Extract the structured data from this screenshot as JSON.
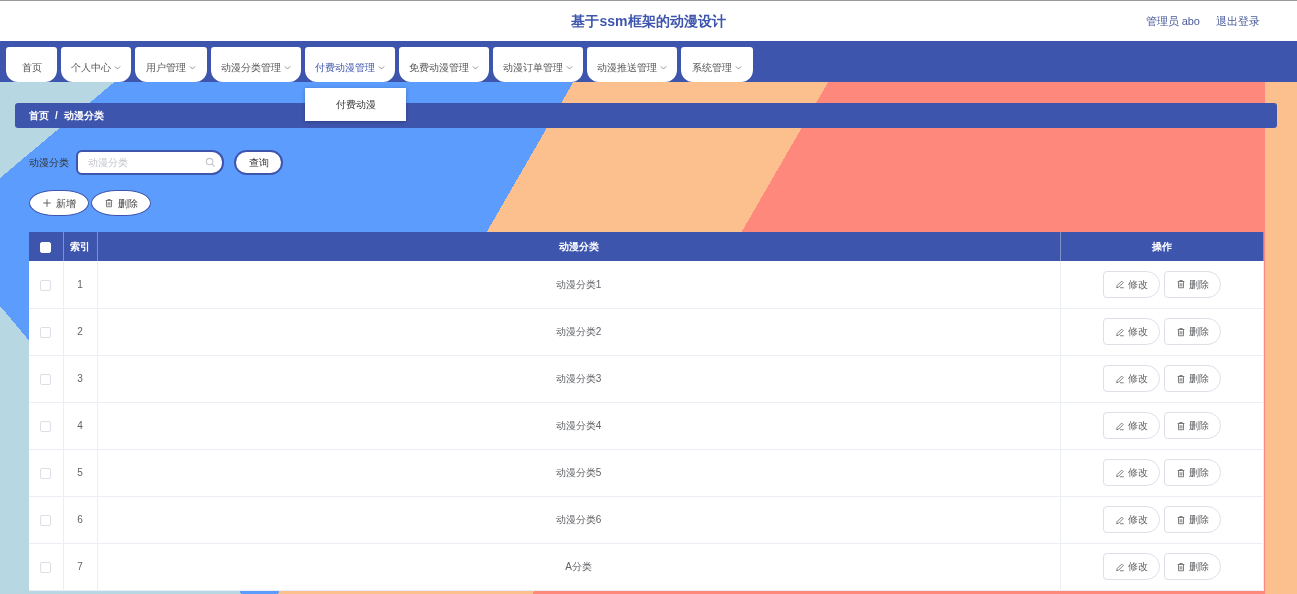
{
  "header": {
    "title": "基于ssm框架的动漫设计",
    "user": "管理员 abo",
    "logout": "退出登录"
  },
  "nav": [
    {
      "label": "首页",
      "has_menu": false,
      "expanded": false
    },
    {
      "label": "个人中心",
      "has_menu": true,
      "expanded": false
    },
    {
      "label": "用户管理",
      "has_menu": true,
      "expanded": false
    },
    {
      "label": "动漫分类管理",
      "has_menu": true,
      "expanded": false
    },
    {
      "label": "付费动漫管理",
      "has_menu": true,
      "expanded": true,
      "menu": [
        "付费动漫"
      ]
    },
    {
      "label": "免费动漫管理",
      "has_menu": true,
      "expanded": false
    },
    {
      "label": "动漫订单管理",
      "has_menu": true,
      "expanded": false
    },
    {
      "label": "动漫推送管理",
      "has_menu": true,
      "expanded": false
    },
    {
      "label": "系统管理",
      "has_menu": true,
      "expanded": false
    }
  ],
  "breadcrumb": {
    "items": [
      "首页",
      "动漫分类"
    ],
    "separator": "/"
  },
  "search": {
    "label": "动漫分类",
    "placeholder": "动漫分类",
    "button": "查询"
  },
  "actions": [
    {
      "kind": "add",
      "label": "新增"
    },
    {
      "kind": "delete",
      "label": "删除"
    }
  ],
  "table": {
    "select_all_checked": false,
    "columns": [
      "索引",
      "动漫分类",
      "操作"
    ],
    "rows": [
      {
        "checked": false,
        "index": "1",
        "category": "动漫分类1",
        "actions": [
          {
            "kind": "edit",
            "label": "修改"
          },
          {
            "kind": "delete",
            "label": "删除"
          }
        ]
      },
      {
        "checked": false,
        "index": "2",
        "category": "动漫分类2",
        "actions": [
          {
            "kind": "edit",
            "label": "修改"
          },
          {
            "kind": "delete",
            "label": "删除"
          }
        ]
      },
      {
        "checked": false,
        "index": "3",
        "category": "动漫分类3",
        "actions": [
          {
            "kind": "edit",
            "label": "修改"
          },
          {
            "kind": "delete",
            "label": "删除"
          }
        ]
      },
      {
        "checked": false,
        "index": "4",
        "category": "动漫分类4",
        "actions": [
          {
            "kind": "edit",
            "label": "修改"
          },
          {
            "kind": "delete",
            "label": "删除"
          }
        ]
      },
      {
        "checked": false,
        "index": "5",
        "category": "动漫分类5",
        "actions": [
          {
            "kind": "edit",
            "label": "修改"
          },
          {
            "kind": "delete",
            "label": "删除"
          }
        ]
      },
      {
        "checked": false,
        "index": "6",
        "category": "动漫分类6",
        "actions": [
          {
            "kind": "edit",
            "label": "修改"
          },
          {
            "kind": "delete",
            "label": "删除"
          }
        ]
      },
      {
        "checked": false,
        "index": "7",
        "category": "A分类",
        "actions": [
          {
            "kind": "edit",
            "label": "修改"
          },
          {
            "kind": "delete",
            "label": "删除"
          }
        ]
      }
    ]
  }
}
